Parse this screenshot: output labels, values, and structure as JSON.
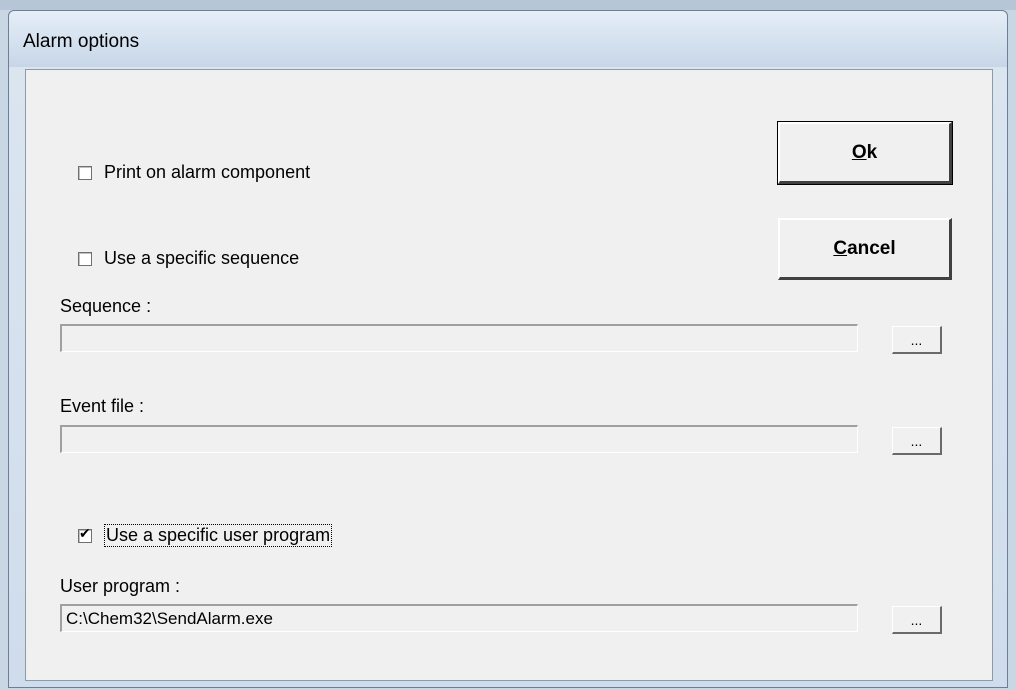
{
  "window": {
    "title": "Alarm options"
  },
  "options": {
    "print_on_alarm": {
      "label": "Print on alarm component",
      "checked": false
    },
    "use_sequence": {
      "label": "Use a specific sequence",
      "checked": false
    },
    "use_user_program": {
      "label": "Use a specific user program",
      "checked": true
    }
  },
  "fields": {
    "sequence": {
      "label": "Sequence :",
      "value": ""
    },
    "event_file": {
      "label": "Event file :",
      "value": ""
    },
    "user_program": {
      "label": "User program :",
      "value": "C:\\Chem32\\SendAlarm.exe"
    }
  },
  "browse_label": "...",
  "buttons": {
    "ok": {
      "mnemonic": "O",
      "rest": "k"
    },
    "cancel": {
      "mnemonic": "C",
      "rest": "ancel"
    }
  }
}
